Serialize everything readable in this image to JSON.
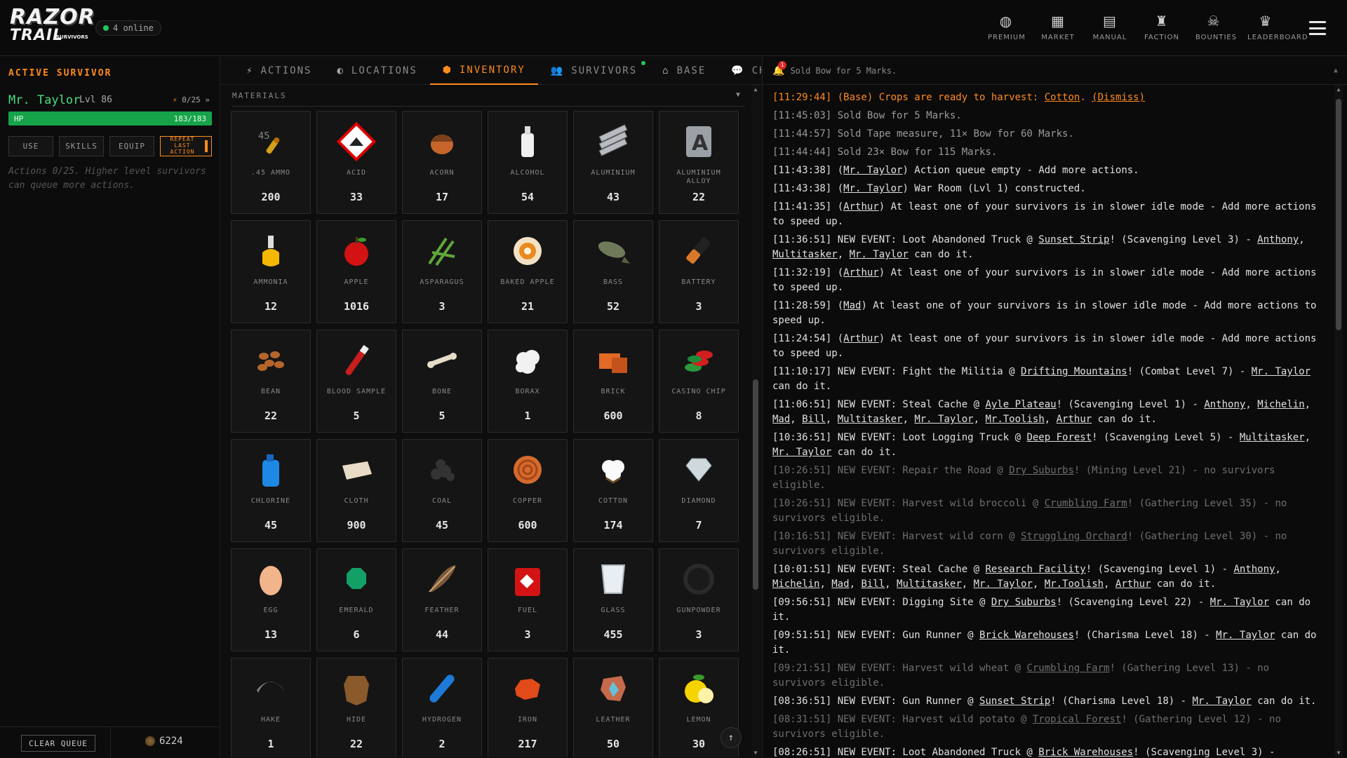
{
  "app": {
    "logo_line1": "RAZOR",
    "logo_line2": "TRAIL",
    "logo_line3": "SURVIVORS",
    "online": "4 online"
  },
  "topnav": [
    {
      "label": "PREMIUM",
      "icon": "globe-icon"
    },
    {
      "label": "MARKET",
      "icon": "market-icon"
    },
    {
      "label": "MANUAL",
      "icon": "manual-icon"
    },
    {
      "label": "FACTION",
      "icon": "faction-icon"
    },
    {
      "label": "BOUNTIES",
      "icon": "skull-icon"
    },
    {
      "label": "LEADERBOARD",
      "icon": "trophy-icon"
    }
  ],
  "survivor": {
    "heading": "ACTIVE SURVIVOR",
    "name": "Mr. Taylor",
    "level": "Lvl 86",
    "queue": "0/25",
    "queue_more": "»",
    "hp_label": "HP",
    "hp_value": "183/183",
    "hp_fraction": 1.0,
    "buttons": {
      "use": "USE",
      "skills": "SKILLS",
      "equip": "EQUIP",
      "repeat": "REPEAT LAST ACTION"
    },
    "hint": "Actions 0/25. Higher level survivors can queue more actions.",
    "clear_queue": "CLEAR QUEUE",
    "coins": "6224"
  },
  "tabs": [
    {
      "label": "ACTIONS",
      "icon": "bolt-icon",
      "active": false
    },
    {
      "label": "LOCATIONS",
      "icon": "location-icon",
      "active": false
    },
    {
      "label": "INVENTORY",
      "icon": "box-icon",
      "active": true
    },
    {
      "label": "SURVIVORS",
      "icon": "people-icon",
      "active": false,
      "dot": "#22c55e"
    },
    {
      "label": "BASE",
      "icon": "base-icon",
      "active": false
    },
    {
      "label": "CHAT",
      "icon": "chat-icon",
      "active": false,
      "dot": "#ff8a1e"
    }
  ],
  "inventory": {
    "section": "MATERIALS",
    "items": [
      {
        "name": ".45 AMMO",
        "count": "200",
        "icon": "ammo-icon"
      },
      {
        "name": "ACID",
        "count": "33",
        "icon": "acid-icon"
      },
      {
        "name": "ACORN",
        "count": "17",
        "icon": "acorn-icon"
      },
      {
        "name": "ALCOHOL",
        "count": "54",
        "icon": "alcohol-icon"
      },
      {
        "name": "ALUMINIUM",
        "count": "43",
        "icon": "aluminium-icon"
      },
      {
        "name": "ALUMINIUM ALLOY",
        "count": "22",
        "icon": "alloy-icon"
      },
      {
        "name": "AMMONIA",
        "count": "12",
        "icon": "ammonia-icon"
      },
      {
        "name": "APPLE",
        "count": "1016",
        "icon": "apple-icon"
      },
      {
        "name": "ASPARAGUS",
        "count": "3",
        "icon": "asparagus-icon"
      },
      {
        "name": "BAKED APPLE",
        "count": "21",
        "icon": "baked-apple-icon"
      },
      {
        "name": "BASS",
        "count": "52",
        "icon": "fish-icon"
      },
      {
        "name": "BATTERY",
        "count": "3",
        "icon": "battery-icon"
      },
      {
        "name": "BEAN",
        "count": "22",
        "icon": "bean-icon"
      },
      {
        "name": "BLOOD SAMPLE",
        "count": "5",
        "icon": "blood-sample-icon"
      },
      {
        "name": "BONE",
        "count": "5",
        "icon": "bone-icon"
      },
      {
        "name": "BORAX",
        "count": "1",
        "icon": "borax-icon"
      },
      {
        "name": "BRICK",
        "count": "600",
        "icon": "brick-icon"
      },
      {
        "name": "CASINO CHIP",
        "count": "8",
        "icon": "casino-chip-icon"
      },
      {
        "name": "CHLORINE",
        "count": "45",
        "icon": "chlorine-icon"
      },
      {
        "name": "CLOTH",
        "count": "900",
        "icon": "cloth-icon"
      },
      {
        "name": "COAL",
        "count": "45",
        "icon": "coal-icon"
      },
      {
        "name": "COPPER",
        "count": "600",
        "icon": "copper-icon"
      },
      {
        "name": "COTTON",
        "count": "174",
        "icon": "cotton-icon"
      },
      {
        "name": "DIAMOND",
        "count": "7",
        "icon": "diamond-icon"
      },
      {
        "name": "EGG",
        "count": "13",
        "icon": "egg-icon"
      },
      {
        "name": "EMERALD",
        "count": "6",
        "icon": "emerald-icon"
      },
      {
        "name": "FEATHER",
        "count": "44",
        "icon": "feather-icon"
      },
      {
        "name": "FUEL",
        "count": "3",
        "icon": "fuel-icon"
      },
      {
        "name": "GLASS",
        "count": "455",
        "icon": "glass-icon"
      },
      {
        "name": "GUNPOWDER",
        "count": "3",
        "icon": "gunpowder-icon"
      },
      {
        "name": "HAKE",
        "count": "1",
        "icon": "hake-icon"
      },
      {
        "name": "HIDE",
        "count": "22",
        "icon": "hide-icon"
      },
      {
        "name": "HYDROGEN",
        "count": "2",
        "icon": "hydrogen-icon"
      },
      {
        "name": "IRON",
        "count": "217",
        "icon": "iron-icon"
      },
      {
        "name": "LEATHER",
        "count": "50",
        "icon": "leather-icon"
      },
      {
        "name": "LEMON",
        "count": "30",
        "icon": "lemon-icon"
      }
    ]
  },
  "notification": {
    "text": "Sold Bow for 5 Marks.",
    "badge": "1"
  },
  "log": [
    {
      "style": "first",
      "html": "[11:29:44] (Base) Crops are ready to harvest: <u>Cotton</u>. <u>(Dismiss)</u>"
    },
    {
      "style": "gray",
      "html": "[11:45:03] Sold Bow for 5 Marks."
    },
    {
      "style": "gray",
      "html": "[11:44:57] Sold Tape measure, 11× Bow for 60 Marks."
    },
    {
      "style": "gray",
      "html": "[11:44:44] Sold 23× Bow for 115 Marks."
    },
    {
      "style": "",
      "html": "[11:43:38] (<u>Mr. Taylor</u>) Action queue empty - Add more actions."
    },
    {
      "style": "",
      "html": "[11:43:38] (<u>Mr. Taylor</u>) War Room (Lvl 1) constructed."
    },
    {
      "style": "",
      "html": "[11:41:35] (<u>Arthur</u>) At least one of your survivors is in slower idle mode - Add more actions to speed up."
    },
    {
      "style": "",
      "html": "[11:36:51] NEW EVENT: Loot Abandoned Truck @ <u>Sunset Strip</u>! (Scavenging Level 3) - <u>Anthony</u>, <u>Multitasker</u>, <u>Mr. Taylor</u> can do it."
    },
    {
      "style": "",
      "html": "[11:32:19] (<u>Arthur</u>) At least one of your survivors is in slower idle mode - Add more actions to speed up."
    },
    {
      "style": "",
      "html": "[11:28:59] (<u>Mad</u>) At least one of your survivors is in slower idle mode - Add more actions to speed up."
    },
    {
      "style": "",
      "html": "[11:24:54] (<u>Arthur</u>) At least one of your survivors is in slower idle mode - Add more actions to speed up."
    },
    {
      "style": "",
      "html": "[11:10:17] NEW EVENT: Fight the Militia @ <u>Drifting Mountains</u>! (Combat Level 7) - <u>Mr. Taylor</u> can do it."
    },
    {
      "style": "",
      "html": "[11:06:51] NEW EVENT: Steal Cache @ <u>Ayle Plateau</u>! (Scavenging Level 1) - <u>Anthony</u>, <u>Michelin</u>, <u>Mad</u>, <u>Bill</u>, <u>Multitasker</u>, <u>Mr. Taylor</u>, <u>Mr.Toolish</u>, <u>Arthur</u> can do it."
    },
    {
      "style": "",
      "html": "[10:36:51] NEW EVENT: Loot Logging Truck @ <u>Deep Forest</u>! (Scavenging Level 5) - <u>Multitasker</u>, <u>Mr. Taylor</u> can do it."
    },
    {
      "style": "dim",
      "html": "[10:26:51] NEW EVENT: Repair the Road @ <u>Dry Suburbs</u>! (Mining Level 21) - no survivors eligible."
    },
    {
      "style": "dim",
      "html": "[10:26:51] NEW EVENT: Harvest wild broccoli @ <u>Crumbling Farm</u>! (Gathering Level 35) - no survivors eligible."
    },
    {
      "style": "dim",
      "html": "[10:16:51] NEW EVENT: Harvest wild corn @ <u>Struggling Orchard</u>! (Gathering Level 30) - no survivors eligible."
    },
    {
      "style": "",
      "html": "[10:01:51] NEW EVENT: Steal Cache @ <u>Research Facility</u>! (Scavenging Level 1) - <u>Anthony</u>, <u>Michelin</u>, <u>Mad</u>, <u>Bill</u>, <u>Multitasker</u>, <u>Mr. Taylor</u>, <u>Mr.Toolish</u>, <u>Arthur</u> can do it."
    },
    {
      "style": "",
      "html": "[09:56:51] NEW EVENT: Digging Site @ <u>Dry Suburbs</u>! (Scavenging Level 22) - <u>Mr. Taylor</u> can do it."
    },
    {
      "style": "",
      "html": "[09:51:51] NEW EVENT: Gun Runner @ <u>Brick Warehouses</u>! (Charisma Level 18) - <u>Mr. Taylor</u> can do it."
    },
    {
      "style": "dim",
      "html": "[09:21:51] NEW EVENT: Harvest wild wheat @ <u>Crumbling Farm</u>! (Gathering Level 13) - no survivors eligible."
    },
    {
      "style": "",
      "html": "[08:36:51] NEW EVENT: Gun Runner @ <u>Sunset Strip</u>! (Charisma Level 18) - <u>Mr. Taylor</u> can do it."
    },
    {
      "style": "dim",
      "html": "[08:31:51] NEW EVENT: Harvest wild potato @ <u>Tropical Forest</u>! (Gathering Level 12) - no survivors eligible."
    },
    {
      "style": "",
      "html": "[08:26:51] NEW EVENT: Loot Abandoned Truck @ <u>Brick Warehouses</u>! (Scavenging Level 3) -"
    }
  ]
}
